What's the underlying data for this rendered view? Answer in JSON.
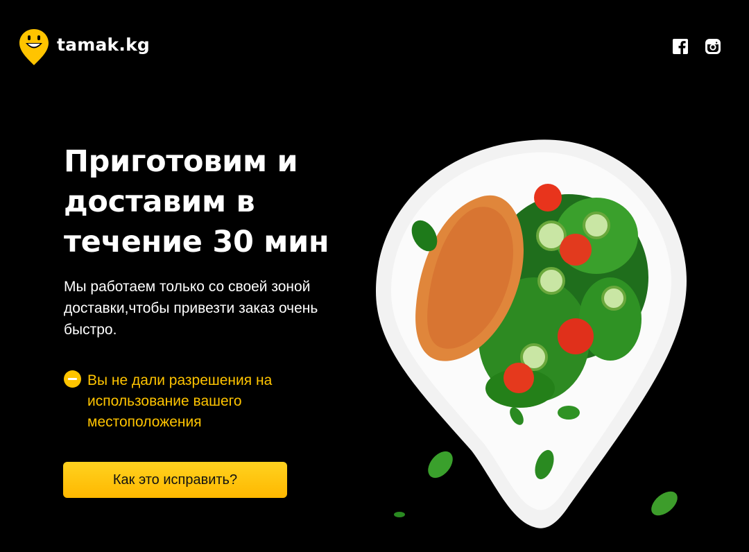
{
  "header": {
    "logo_text": "tamak.kg",
    "icons": [
      "facebook-icon",
      "instagram-icon"
    ]
  },
  "hero": {
    "title_line1": "Приготовим и",
    "title_line2": "доставим в",
    "title_line3": "течение 30 мин",
    "description": "Мы работаем только со своей зоной доставки,чтобы привезти заказ очень быстро."
  },
  "location_warning": {
    "icon": "minus-circle-icon",
    "text": "Вы не дали разрешения на использование вашего местоположения"
  },
  "cta": {
    "label": "Как это исправить?"
  },
  "colors": {
    "background": "#000000",
    "accent": "#ffc400",
    "button": "#ffc60b",
    "text": "#ffffff"
  }
}
